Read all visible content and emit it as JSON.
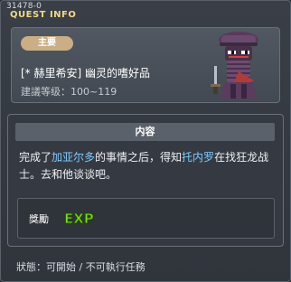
{
  "window": {
    "quest_id": "31478-0",
    "title": "QUEST INFO"
  },
  "quest": {
    "type_badge": "主要",
    "name": "[* 赫里希安] 幽灵的嗜好品",
    "level_range": "建議等级：100~119"
  },
  "content": {
    "header": "内容",
    "description_parts": {
      "p1": "完成了",
      "npc1": "加亚尔多",
      "p2": "的事情之后，得知",
      "npc2": "托内罗",
      "p3": "在找狂龙战士。去和他谈谈吧。"
    },
    "reward_label": "獎勵",
    "reward_icon": "exp-icon",
    "reward_icon_text": "EXP"
  },
  "status": {
    "text": "狀態：可開始 / 不可執行任務"
  },
  "colors": {
    "highlight": "#7ec9ff",
    "badge": "#c9ae86",
    "title": "#f2d98a",
    "exp_green": "#7ddc1f"
  }
}
